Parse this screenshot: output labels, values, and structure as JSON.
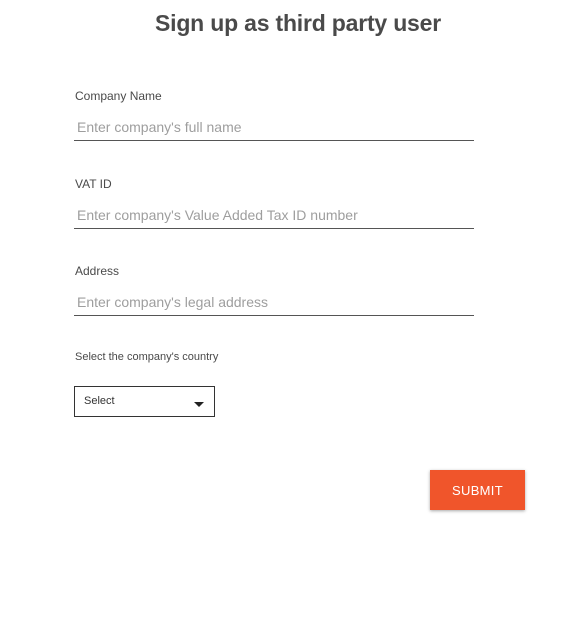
{
  "page": {
    "title": "Sign up as third party user"
  },
  "form": {
    "company_name": {
      "label": "Company Name",
      "value": "",
      "placeholder": "Enter company's full name"
    },
    "vat_id": {
      "label": "VAT ID",
      "value": "",
      "placeholder": "Enter company's Value Added Tax ID number"
    },
    "address": {
      "label": "Address",
      "value": "",
      "placeholder": "Enter company's legal address"
    },
    "country": {
      "label": "Select the company's country",
      "selected": "Select",
      "caret_icon": "caret-down-icon"
    },
    "submit_label": "SUBMIT"
  },
  "colors": {
    "accent": "#f0552b",
    "title": "#4a4a4a",
    "placeholder": "#9e9e9e",
    "underline": "#555555"
  }
}
